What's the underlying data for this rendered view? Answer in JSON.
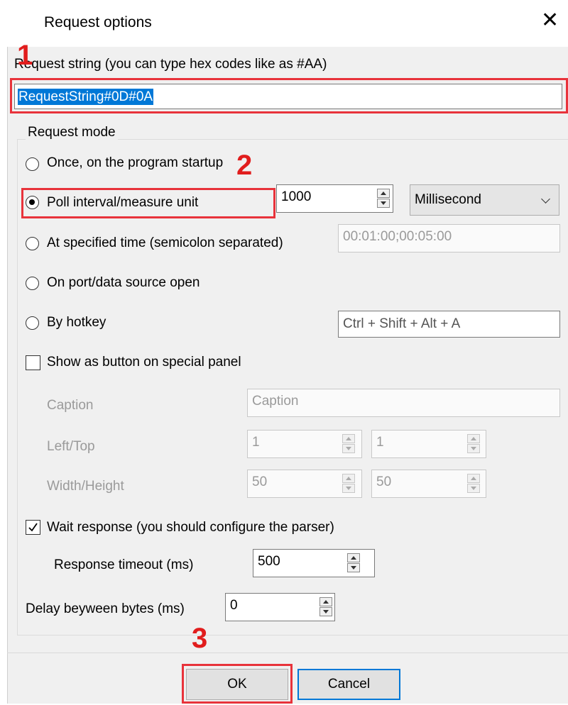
{
  "dialog": {
    "title": "Request options"
  },
  "request": {
    "label": "Request string (you can type hex codes like as #AA)",
    "value": "RequestString#0D#0A"
  },
  "mode": {
    "group_label": "Request mode",
    "once_label": "Once, on the program startup",
    "poll_label": "Poll interval/measure unit",
    "poll_value": "1000",
    "poll_unit": "Millisecond",
    "specified_label": "At specified time (semicolon separated)",
    "specified_value": "00:01:00;00:05:00",
    "port_label": "On port/data source open",
    "hotkey_label": "By hotkey",
    "hotkey_value": "Ctrl + Shift + Alt + A",
    "selected": "poll"
  },
  "panel": {
    "show_label": "Show as button on special panel",
    "show_checked": false,
    "caption_label": "Caption",
    "caption_value": "Caption",
    "lefttop_label": "Left/Top",
    "left_value": "1",
    "top_value": "1",
    "wh_label": "Width/Height",
    "width_value": "50",
    "height_value": "50"
  },
  "response": {
    "wait_label": "Wait response (you should configure the parser)",
    "wait_checked": true,
    "timeout_label": "Response timeout (ms)",
    "timeout_value": "500"
  },
  "delay": {
    "label": "Delay beyween bytes (ms)",
    "value": "0"
  },
  "buttons": {
    "ok": "OK",
    "cancel": "Cancel"
  },
  "annotations": {
    "one": "1",
    "two": "2",
    "three": "3"
  },
  "colors": {
    "highlight": "#e8333b",
    "accent": "#0078d7",
    "number": "#e11d1d"
  }
}
